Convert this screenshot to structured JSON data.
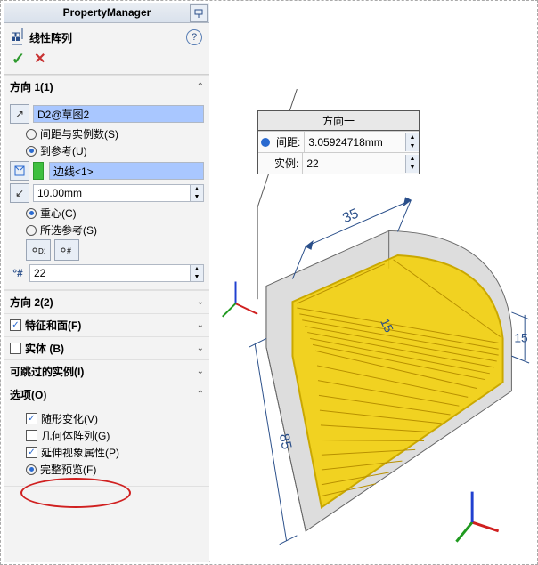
{
  "header": {
    "title": "PropertyManager"
  },
  "feature": {
    "name": "线性阵列"
  },
  "direction1": {
    "head": "方向 1(1)",
    "ref": "D2@草图2",
    "opt_spacing": "间距与实例数(S)",
    "opt_upto": "到参考(U)",
    "edge": "边线<1>",
    "offset": "10.00mm",
    "opt_centroid": "重心(C)",
    "opt_selref": "所选参考(S)",
    "count": "22"
  },
  "direction2": {
    "head": "方向 2(2)"
  },
  "features": {
    "head": "特征和面(F)"
  },
  "bodies": {
    "head": "实体 (B)"
  },
  "skip": {
    "head": "可跳过的实例(I)"
  },
  "options": {
    "head": "选项(O)",
    "vary": "随形变化(V)",
    "geom": "几何体阵列(G)",
    "propagate": "延伸视象属性(P)",
    "fullpreview": "完整预览(F)"
  },
  "callout": {
    "title": "方向一",
    "spacing_label": "间距:",
    "spacing_val": "3.05924718mm",
    "inst_label": "实例:",
    "inst_val": "22"
  },
  "dims": {
    "d35": "35",
    "d15a": "15",
    "d15b": "15",
    "d85": "85"
  }
}
